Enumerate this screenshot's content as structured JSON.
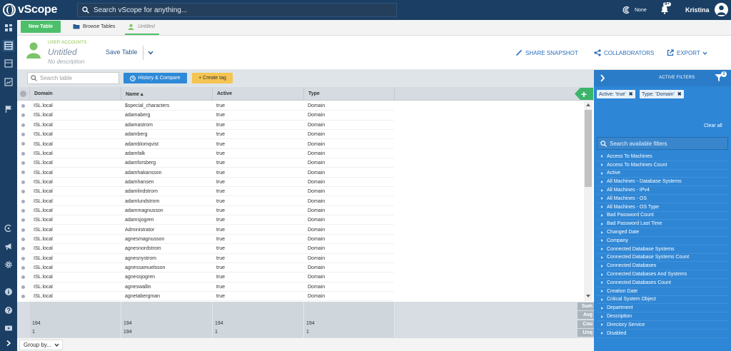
{
  "app": {
    "name": "vScope",
    "search_placeholder": "Search vScope for anything...",
    "connection_status": "None",
    "notifications": "9+",
    "user": "Kristina"
  },
  "tabs": {
    "new_table": "New Table",
    "browse": "Browse Tables",
    "current": "Untitled"
  },
  "header": {
    "category": "USER ACCOUNTS",
    "title": "Untitled",
    "description": "No description",
    "save": "Save Table",
    "actions": {
      "share": "SHARE SNAPSHOT",
      "collaborators": "COLLABORATORS",
      "export": "EXPORT"
    }
  },
  "toolbar": {
    "search_placeholder": "Search table",
    "history": "History & Compare",
    "create_tag": "+ Create tag"
  },
  "table": {
    "columns": [
      "Domain",
      "Name ▴",
      "Active",
      "Type"
    ],
    "rows": [
      [
        "ISL.local",
        "$special_characters",
        "true",
        "Domain"
      ],
      [
        "ISL.local",
        "adamaberg",
        "true",
        "Domain"
      ],
      [
        "ISL.local",
        "adamastrom",
        "true",
        "Domain"
      ],
      [
        "ISL.local",
        "adamberg",
        "true",
        "Domain"
      ],
      [
        "ISL.local",
        "adamblomqvist",
        "true",
        "Domain"
      ],
      [
        "ISL.local",
        "adamfalk",
        "true",
        "Domain"
      ],
      [
        "ISL.local",
        "adamforsberg",
        "true",
        "Domain"
      ],
      [
        "ISL.local",
        "adamhakansson",
        "true",
        "Domain"
      ],
      [
        "ISL.local",
        "adamhansen",
        "true",
        "Domain"
      ],
      [
        "ISL.local",
        "adamlindstrom",
        "true",
        "Domain"
      ],
      [
        "ISL.local",
        "adamlundstrom",
        "true",
        "Domain"
      ],
      [
        "ISL.local",
        "adammagnusson",
        "true",
        "Domain"
      ],
      [
        "ISL.local",
        "adamsjogren",
        "true",
        "Domain"
      ],
      [
        "ISL.local",
        "Administrator",
        "true",
        "Domain"
      ],
      [
        "ISL.local",
        "agnesmagnusson",
        "true",
        "Domain"
      ],
      [
        "ISL.local",
        "agnesnordstrom",
        "true",
        "Domain"
      ],
      [
        "ISL.local",
        "agnesnystrom",
        "true",
        "Domain"
      ],
      [
        "ISL.local",
        "agnessamuelsson",
        "true",
        "Domain"
      ],
      [
        "ISL.local",
        "agnessjogren",
        "true",
        "Domain"
      ],
      [
        "ISL.local",
        "agneswallin",
        "true",
        "Domain"
      ],
      [
        "ISL.local",
        "agnetabergman",
        "true",
        "Domain"
      ]
    ],
    "aggregates": {
      "labels": [
        "Sum",
        "Avg",
        "Cou",
        "Unq"
      ],
      "count": [
        "194",
        "194",
        "194",
        "194"
      ],
      "unique": [
        "1",
        "194",
        "1",
        "1"
      ]
    }
  },
  "footer": {
    "group_by": "Group by..."
  },
  "filters": {
    "title": "ACTIVE FILTERS",
    "count": "2",
    "active": [
      "Active: 'true'",
      "Type: 'Domain'"
    ],
    "clear_all": "Clear all",
    "search_placeholder": "Search available filters",
    "available": [
      "Access To Machines",
      "Access To Machines Count",
      "Active",
      "All Machines - Database Systems",
      "All Machines - IPv4",
      "All Machines - OS",
      "All Machines - OS Type",
      "Bad Password Count",
      "Bad Password Last Time",
      "Changed Date",
      "Company",
      "Connected Database Systems",
      "Connected Database Systems Count",
      "Connected Databases",
      "Connected Databases And Systems",
      "Connected Databases Count",
      "Creation Date",
      "Critical System Object",
      "Department",
      "Description",
      "Directory Service",
      "Disabled"
    ]
  },
  "colors": {
    "navy": "#1b3f64",
    "green": "#4dbf6a",
    "blue": "#2e86d6",
    "yellow": "#f5c451"
  }
}
